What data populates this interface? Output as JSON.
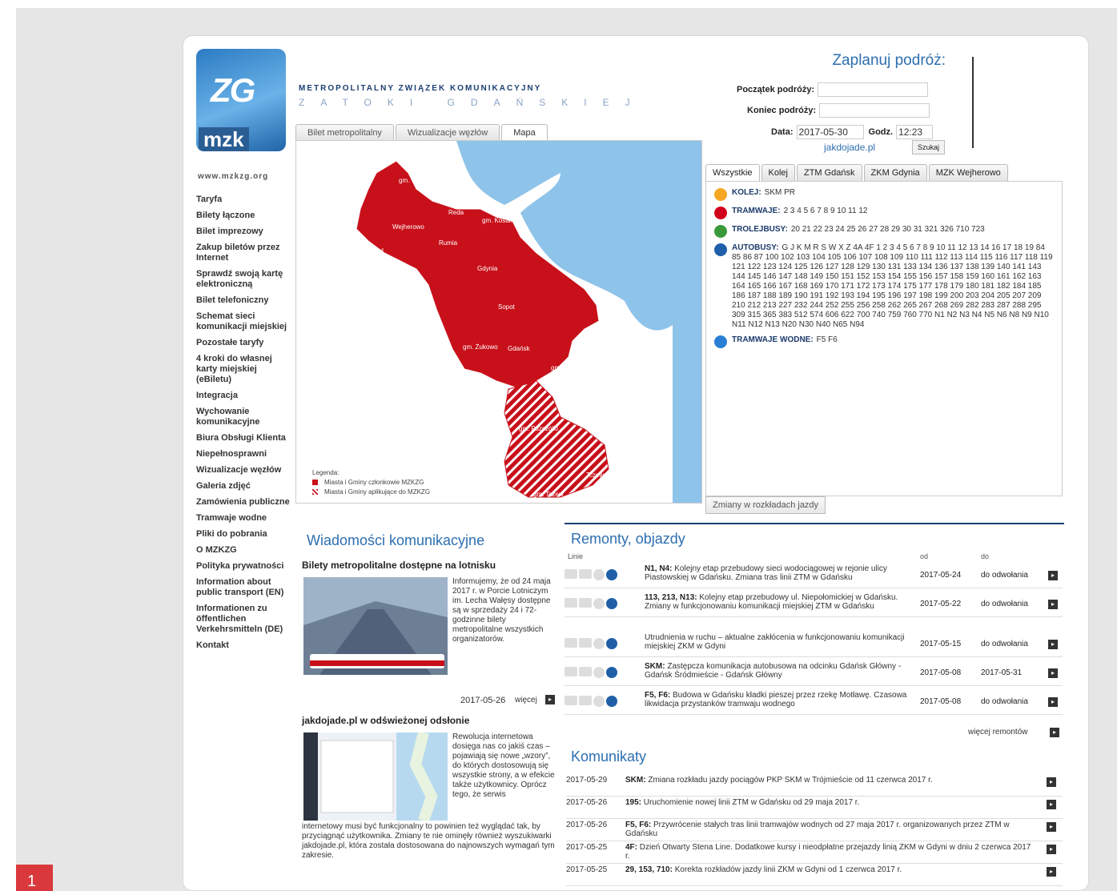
{
  "slide_number": "1",
  "logo": {
    "letters": "ZG",
    "acronym": "mzk",
    "url": "www.mzkzg.org"
  },
  "header": {
    "org_name": "METROPOLITALNY ZWIĄZEK KOMUNIKACYJNY",
    "org_sub": "ZATOKI GDAŃSKIEJ"
  },
  "nav": [
    "Taryfa",
    "Bilety łączone",
    "Bilet imprezowy",
    "Zakup biletów przez Internet",
    "Sprawdź swoją kartę elektroniczną",
    "Bilet telefoniczny",
    "Schemat sieci komunikacji miejskiej",
    "Pozostałe taryfy",
    "4 kroki do własnej karty miejskiej (eBiletu)",
    "Integracja",
    "Wychowanie komunikacyjne",
    "Biura Obsługi Klienta",
    "Niepełnosprawni",
    "Wizualizacje węzłów",
    "Galeria zdjęć",
    "Zamówienia publiczne",
    "Tramwaje wodne",
    "Pliki do pobrania",
    "O MZKZG",
    "Polityka prywatności",
    "Information about public transport (EN)",
    "Informationen zu öffentlichen Verkehrsmitteln (DE)",
    "Kontakt"
  ],
  "map_tabs": [
    "Bilet metropolitalny",
    "Wizualizacje węzłów",
    "Mapa"
  ],
  "map": {
    "labels": [
      "gm. Wejherowo",
      "Reda",
      "Wejherowo",
      "gm. Kosakowo",
      "gm. Szemud",
      "Rumia",
      "gm. Szemud",
      "Gdynia",
      "Sopot",
      "gm. Żukowo",
      "Gdańsk",
      "gm. Pruszcz Gdański",
      "Pruszcz Gdański",
      "gm. Kolbudy",
      "gm. Pszczółki",
      "Tczew",
      "gm. Tczew"
    ],
    "legend_title": "Legenda:",
    "legend_items": [
      "Miasta i Gminy członkowie MZKZG",
      "Miasta i Gminy aplikujące do MZKZG"
    ]
  },
  "planner": {
    "title": "Zaplanuj podróż:",
    "start_label": "Początek podróży:",
    "start_value": "",
    "end_label": "Koniec podróży:",
    "end_value": "",
    "date_label": "Data:",
    "date_value": "2017-05-30",
    "time_label": "Godz.",
    "time_value": "12:23",
    "provider": "jakdojade.pl",
    "search_label": "Szukaj"
  },
  "line_tabs": [
    "Wszystkie",
    "Kolej",
    "ZTM Gdańsk",
    "ZKM Gdynia",
    "MZK Wejherowo"
  ],
  "lines": [
    {
      "name": "KOLEJ:",
      "values": "SKM PR",
      "color": "#f5a623"
    },
    {
      "name": "TRAMWAJE:",
      "values": "2 3 4 5 6 7 8 9 10 11 12",
      "color": "#d0021b"
    },
    {
      "name": "TROLEJBUSY:",
      "values": "20 21 22 23 24 25 26 27 28 29 30 31 321 326 710 723",
      "color": "#3a9a3a"
    },
    {
      "name": "AUTOBUSY:",
      "values": "G J K M R S W X Z 4A 4F 1 2 3 4 5 6 7 8 9 10 11 12 13 14 16 17 18 19 84 85 86 87 100 102 103 104 105 106 107 108 109 110 111 112 113 114 115 116 117 118 119 121 122 123 124 125 126 127 128 129 130 131 133 134 136 137 138 139 140 141 143 144 145 146 147 148 149 150 151 152 153 154 155 156 157 158 159 160 161 162 163 164 165 166 167 168 169 170 171 172 173 174 175 177 178 179 180 181 182 184 185 186 187 188 189 190 191 192 193 194 195 196 197 198 199 200 203 204 205 207 209 210 212 213 227 232 244 252 255 256 258 262 265 267 268 269 282 283 287 288 295 309 315 365 383 512 574 606 622 700 740 759 760 770 N1 N2 N3 N4 N5 N6 N8 N9 N10 N11 N12 N13 N20 N30 N40 N65 N94",
      "color": "#1f5fa8"
    },
    {
      "name": "TRAMWAJE WODNE:",
      "values": "F5 F6",
      "color": "#2a7fd4"
    }
  ],
  "changes_button": "Zmiany w rozkładach jazdy",
  "news": {
    "title": "Wiadomości komunikacyjne",
    "items": [
      {
        "headline": "Bilety metropolitalne dostępne na lotnisku",
        "text": "Informujemy, że od 24 maja 2017 r. w Porcie Lotniczym im. Lecha Wałęsy dostępne są w sprzedaży 24 i 72-godzinne bilety metropolitalne wszystkich organizatorów.",
        "date": "2017-05-26",
        "more": "więcej"
      },
      {
        "headline": "jakdojade.pl w odświeżonej odsłonie",
        "text": "Rewolucja internetowa dosięga nas co jakiś czas – pojawiają się nowe „wzory”, do których dostosowują się wszystkie strony, a w efekcie także użytkownicy. Oprócz tego, że serwis",
        "text_tail": "internetowy musi być funkcjonalny to powinien też wyglądać tak, by przyciągnąć użytkownika. Zmiany te nie ominęły również wyszukiwarki jakdojade.pl, która została dostosowana do najnowszych wymagań tym zakresie."
      }
    ]
  },
  "remonty": {
    "title": "Remonty, objazdy",
    "col_line": "Linie",
    "col_from": "od",
    "col_to": "do",
    "rows": [
      {
        "lines": "N1, N4:",
        "desc": "Kolejny etap przebudowy sieci wodociągowej w rejonie ulicy Piastowskiej w Gdańsku. Zmiana tras linii ZTM w Gdańsku",
        "from": "2017-05-24",
        "to": "do odwołania"
      },
      {
        "lines": "113, 213, N13:",
        "desc": "Kolejny etap przebudowy ul. Niepołomickiej w Gdańsku. Zmiany w funkcjonowaniu komunikacji miejskiej ZTM w Gdańsku",
        "from": "2017-05-22",
        "to": "do odwołania"
      },
      {
        "lines": "",
        "desc": "Utrudnienia w ruchu – aktualne zakłócenia w funkcjonowaniu komunikacji miejskiej ZKM w Gdyni",
        "from": "2017-05-15",
        "to": "do odwołania"
      },
      {
        "lines": "SKM:",
        "desc": "Zastępcza komunikacja autobusowa na odcinku Gdańsk Główny - Gdańsk Śródmieście - Gdańsk Główny",
        "from": "2017-05-08",
        "to": "2017-05-31"
      },
      {
        "lines": "F5, F6:",
        "desc": "Budowa w Gdańsku kładki pieszej przez rzekę Motławę. Czasowa likwidacja przystanków tramwaju wodnego",
        "from": "2017-05-08",
        "to": "do odwołania"
      }
    ],
    "more": "więcej remontów"
  },
  "komunikaty": {
    "title": "Komunikaty",
    "rows": [
      {
        "date": "2017-05-29",
        "lines": "SKM:",
        "text": "Zmiana rozkładu jazdy pociągów PKP SKM w Trójmieście od 11 czerwca 2017 r."
      },
      {
        "date": "2017-05-26",
        "lines": "195:",
        "text": "Uruchomienie nowej linii ZTM w Gdańsku od 29 maja 2017 r."
      },
      {
        "date": "2017-05-26",
        "lines": "F5, F6:",
        "text": "Przywrócenie stałych tras linii tramwajów wodnych od 27 maja 2017 r. organizowanych przez ZTM w Gdańsku"
      },
      {
        "date": "2017-05-25",
        "lines": "4F:",
        "text": "Dzień Otwarty Stena Line. Dodatkowe kursy i nieodpłatne przejazdy linią ZKM w Gdyni w dniu 2 czerwca 2017 r."
      },
      {
        "date": "2017-05-25",
        "lines": "29, 153, 710:",
        "text": "Korekta rozkładów jazdy linii ZKM w Gdyni od 1 czerwca 2017 r."
      }
    ]
  }
}
